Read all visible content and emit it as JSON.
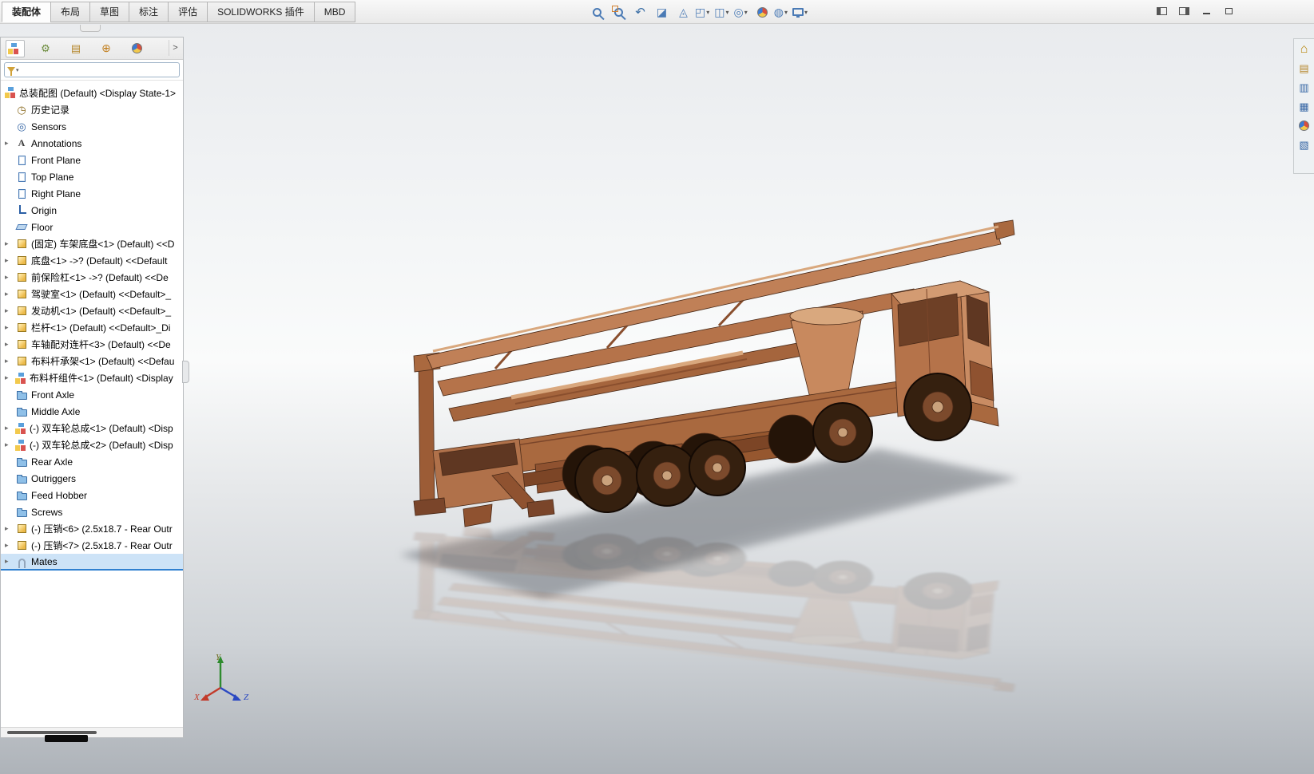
{
  "command_tabs": {
    "items": [
      {
        "label": "装配体",
        "active": true
      },
      {
        "label": "布局",
        "active": false
      },
      {
        "label": "草图",
        "active": false
      },
      {
        "label": "标注",
        "active": false
      },
      {
        "label": "评估",
        "active": false
      },
      {
        "label": "SOLIDWORKS 插件",
        "active": false
      },
      {
        "label": "MBD",
        "active": false
      }
    ]
  },
  "toolbar": {
    "tools": [
      {
        "name": "zoom-to-fit",
        "icon": "magnifier"
      },
      {
        "name": "zoom-to-area",
        "icon": "magnifier-with-box"
      },
      {
        "name": "previous-view",
        "icon": "curved-left-arrow"
      },
      {
        "name": "section-view",
        "icon": "cut-cube"
      },
      {
        "name": "dynamic-annotation-views",
        "icon": "annotation-cube"
      },
      {
        "name": "view-orientation",
        "icon": "orientation-cube",
        "dropdown": true
      },
      {
        "name": "display-style",
        "icon": "shaded-cube",
        "dropdown": true
      },
      {
        "name": "hide-show-items",
        "icon": "eye",
        "dropdown": true
      },
      {
        "name": "edit-appearance",
        "icon": "color-ball"
      },
      {
        "name": "apply-scene",
        "icon": "scene-sphere",
        "dropdown": true
      },
      {
        "name": "view-settings",
        "icon": "monitor",
        "dropdown": true
      }
    ]
  },
  "window_controls": [
    {
      "name": "toggle-left-pane"
    },
    {
      "name": "toggle-right-pane"
    },
    {
      "name": "minimize"
    },
    {
      "name": "maximize"
    }
  ],
  "task_pane": {
    "items": [
      {
        "name": "solidworks-resources",
        "icon": "home"
      },
      {
        "name": "design-library",
        "icon": "library"
      },
      {
        "name": "file-explorer",
        "icon": "files"
      },
      {
        "name": "view-palette",
        "icon": "palette"
      },
      {
        "name": "appearances-scenes",
        "icon": "color-ball"
      },
      {
        "name": "custom-properties",
        "icon": "properties"
      }
    ]
  },
  "panel_tabs": {
    "items": [
      {
        "name": "featuremanager-design-tree",
        "active": true
      },
      {
        "name": "propertymanager",
        "active": false
      },
      {
        "name": "configurationmanager",
        "active": false
      },
      {
        "name": "dimxpertmanager",
        "active": false
      },
      {
        "name": "displaymanager",
        "active": false
      }
    ],
    "expand_chevron": ">"
  },
  "filter": {
    "value": "",
    "placeholder": ""
  },
  "feature_tree": {
    "root": {
      "label": "总装配图 (Default) <Display State-1>"
    },
    "items": [
      {
        "label": "历史记录",
        "icon": "history"
      },
      {
        "label": "Sensors",
        "icon": "sensors"
      },
      {
        "label": "Annotations",
        "icon": "annotations",
        "expandable": true
      },
      {
        "label": "Front Plane",
        "icon": "plane"
      },
      {
        "label": "Top Plane",
        "icon": "plane"
      },
      {
        "label": "Right Plane",
        "icon": "plane"
      },
      {
        "label": "Origin",
        "icon": "origin"
      },
      {
        "label": "Floor",
        "icon": "floor"
      },
      {
        "label": "(固定) 车架底盘<1> (Default) <<D",
        "icon": "part",
        "expandable": true
      },
      {
        "label": "底盘<1> ->? (Default) <<Default",
        "icon": "part",
        "expandable": true
      },
      {
        "label": "前保险杠<1> ->? (Default) <<De",
        "icon": "part",
        "expandable": true
      },
      {
        "label": "驾驶室<1> (Default) <<Default>_",
        "icon": "part",
        "expandable": true
      },
      {
        "label": "发动机<1> (Default) <<Default>_",
        "icon": "part",
        "expandable": true
      },
      {
        "label": "栏杆<1> (Default) <<Default>_Di",
        "icon": "part",
        "expandable": true
      },
      {
        "label": "车轴配对连杆<3> (Default) <<De",
        "icon": "part",
        "expandable": true
      },
      {
        "label": "布料杆承架<1> (Default) <<Defau",
        "icon": "part",
        "expandable": true
      },
      {
        "label": "布料杆组件<1> (Default) <Display",
        "icon": "assembly",
        "expandable": true
      },
      {
        "label": "Front Axle",
        "icon": "folder"
      },
      {
        "label": "Middle Axle",
        "icon": "folder"
      },
      {
        "label": "(-) 双车轮总成<1> (Default) <Disp",
        "icon": "assembly",
        "expandable": true
      },
      {
        "label": "(-) 双车轮总成<2> (Default) <Disp",
        "icon": "assembly",
        "expandable": true
      },
      {
        "label": "Rear Axle",
        "icon": "folder"
      },
      {
        "label": "Outriggers",
        "icon": "folder"
      },
      {
        "label": "Feed Hobber",
        "icon": "folder"
      },
      {
        "label": "Screws",
        "icon": "folder"
      },
      {
        "label": "(-) 压销<6> (2.5x18.7 - Rear Outr",
        "icon": "part",
        "expandable": true
      },
      {
        "label": "(-) 压销<7> (2.5x18.7 - Rear Outr",
        "icon": "part",
        "expandable": true
      },
      {
        "label": "Mates",
        "icon": "mates",
        "expandable": true,
        "selected": true
      }
    ]
  },
  "triad": {
    "x": "X",
    "y": "Y",
    "z": "Z"
  },
  "viewport": {
    "description": "Copper-colored concrete pump truck assembly with folded boom, drop shadow and floor reflection",
    "model_color": "#b5734a",
    "shadow_color": "#70757c",
    "selection_color": "#2f80d0"
  }
}
